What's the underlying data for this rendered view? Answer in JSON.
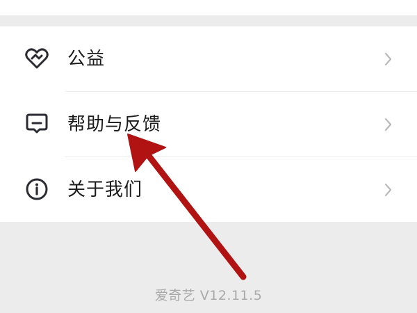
{
  "menu": {
    "items": [
      {
        "label": "公益",
        "icon": "heart-tag-icon"
      },
      {
        "label": "帮助与反馈",
        "icon": "feedback-message-icon"
      },
      {
        "label": "关于我们",
        "icon": "info-circle-icon"
      }
    ]
  },
  "footer": {
    "version": "爱奇艺 V12.11.5"
  },
  "annotation": {
    "type": "red arrow",
    "points_to": "帮助与反馈",
    "color": "#b11212"
  },
  "colors": {
    "page_background": "#ececec",
    "card_background": "#ffffff",
    "icon": "#2b2b33",
    "chevron": "#b9b9b9",
    "version_text": "#a9a9a9"
  }
}
